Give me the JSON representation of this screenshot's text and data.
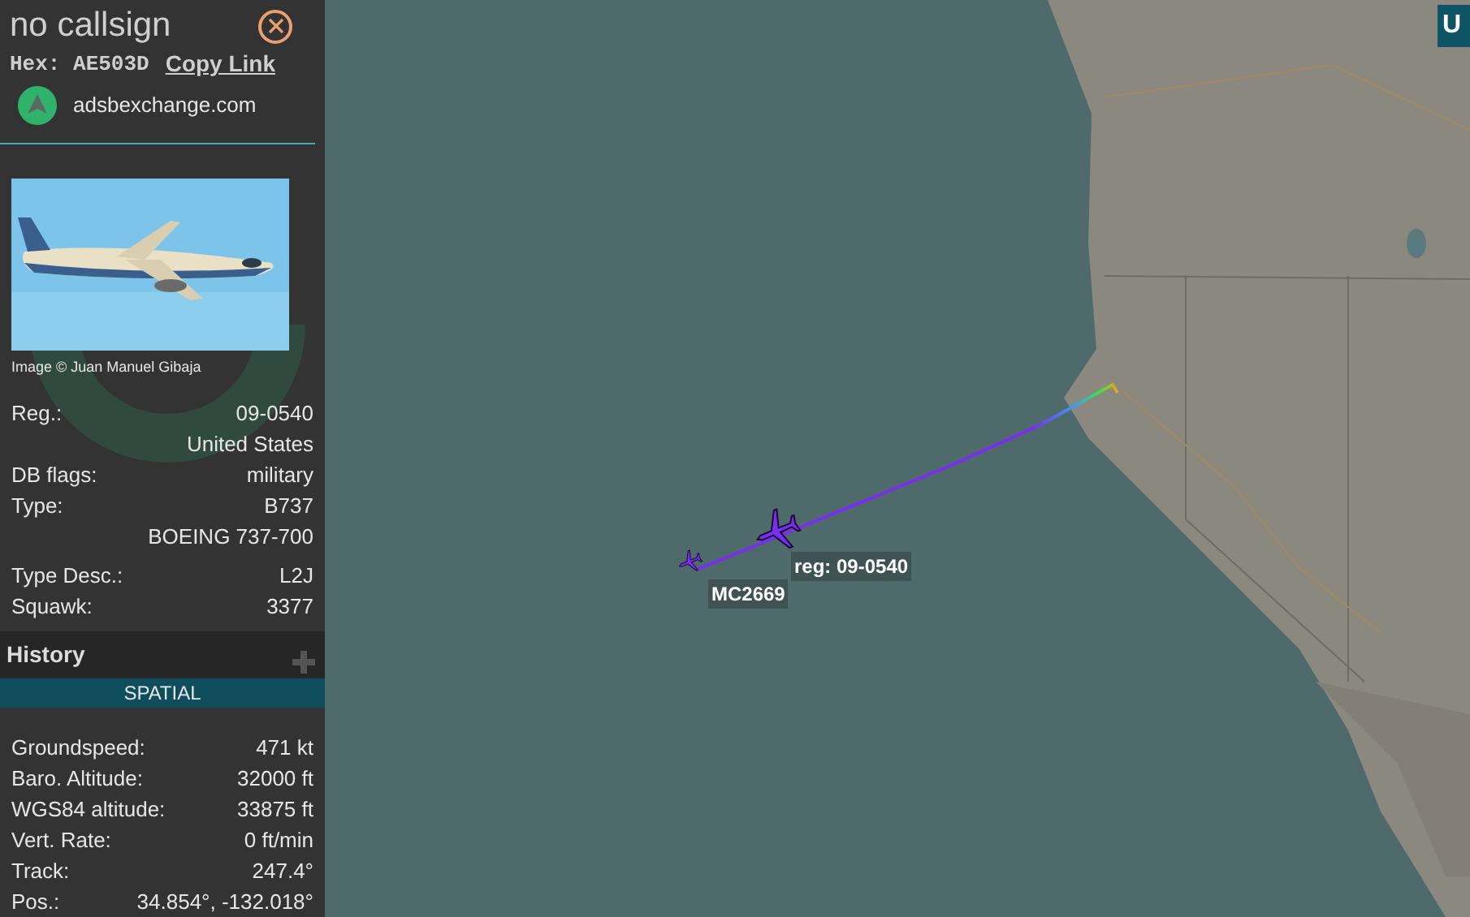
{
  "aircraft": {
    "callsign": "no callsign",
    "hex_label": "Hex:",
    "hex": "AE503D",
    "copy_link": "Copy Link",
    "source": "adsbexchange.com",
    "photo": {
      "kind": "picture",
      "credit": "Image © Juan Manuel Gibaja"
    }
  },
  "details": [
    {
      "label": "Reg.:",
      "value": "09-0540"
    },
    {
      "value": "United States"
    },
    {
      "label": "DB flags:",
      "value": "military"
    },
    {
      "label": "Type:",
      "value": "B737"
    },
    {
      "value": "BOEING 737-700"
    },
    {
      "label": "Type Desc.:",
      "value": "L2J",
      "gap_before": true
    },
    {
      "label": "Squawk:",
      "value": "3377"
    }
  ],
  "history": {
    "title": "History",
    "expanded": false
  },
  "spatial": {
    "title": "SPATIAL",
    "rows": [
      {
        "label": "Groundspeed:",
        "value": "471 kt"
      },
      {
        "label": "Baro. Altitude:",
        "value": "32000 ft"
      },
      {
        "label": "WGS84 altitude:",
        "value": "33875 ft"
      },
      {
        "label": "Vert. Rate:",
        "value": "0 ft/min"
      },
      {
        "label": "Track:",
        "value": "247.4°"
      },
      {
        "label": "Pos.:",
        "value": "34.854°, -132.018°"
      }
    ]
  },
  "map": {
    "corner_button": "U",
    "aircraft": [
      {
        "label": "reg: 09-0540",
        "selected": true
      },
      {
        "label": "MC2669",
        "selected": false
      }
    ]
  }
}
